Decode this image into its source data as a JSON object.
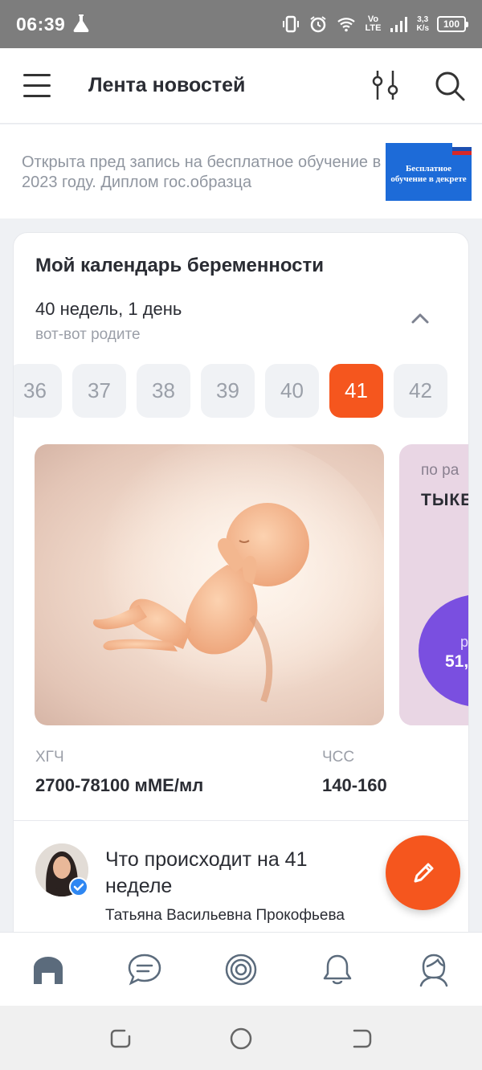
{
  "status_bar": {
    "time": "06:39",
    "network_speed_top": "3,3",
    "network_speed_bottom": "K/s",
    "battery": "100",
    "volte_top": "Vo",
    "volte_bottom": "LTE"
  },
  "app_bar": {
    "title": "Лента новостей"
  },
  "banner": {
    "text": "Открыта пред запись на бесплатное обучение в 2023 году. Диплом гос.образца",
    "ad_text": "Бесплатное обучение в декрете"
  },
  "calendar": {
    "title": "Мой календарь беременности",
    "current_week": "40 недель, 1 день",
    "status": "вот-вот родите",
    "weeks": [
      "36",
      "37",
      "38",
      "39",
      "40",
      "41",
      "42"
    ],
    "selected_week": "41",
    "side_card": {
      "subtitle": "по ра",
      "title": "ТЫКЕ",
      "circle_top": "р",
      "circle_value": "51,"
    },
    "stats": [
      {
        "label": "ХГЧ",
        "value": "2700-78100 мМЕ/мл"
      },
      {
        "label": "ЧСС",
        "value": "140-160"
      }
    ]
  },
  "article": {
    "title": "Что происходит на 41 неделе",
    "author": "Татьяна Васильевна Прокофьева"
  },
  "colors": {
    "accent": "#f5561e",
    "purple": "#7a4fe0",
    "banner_blue": "#1d6bd8"
  }
}
